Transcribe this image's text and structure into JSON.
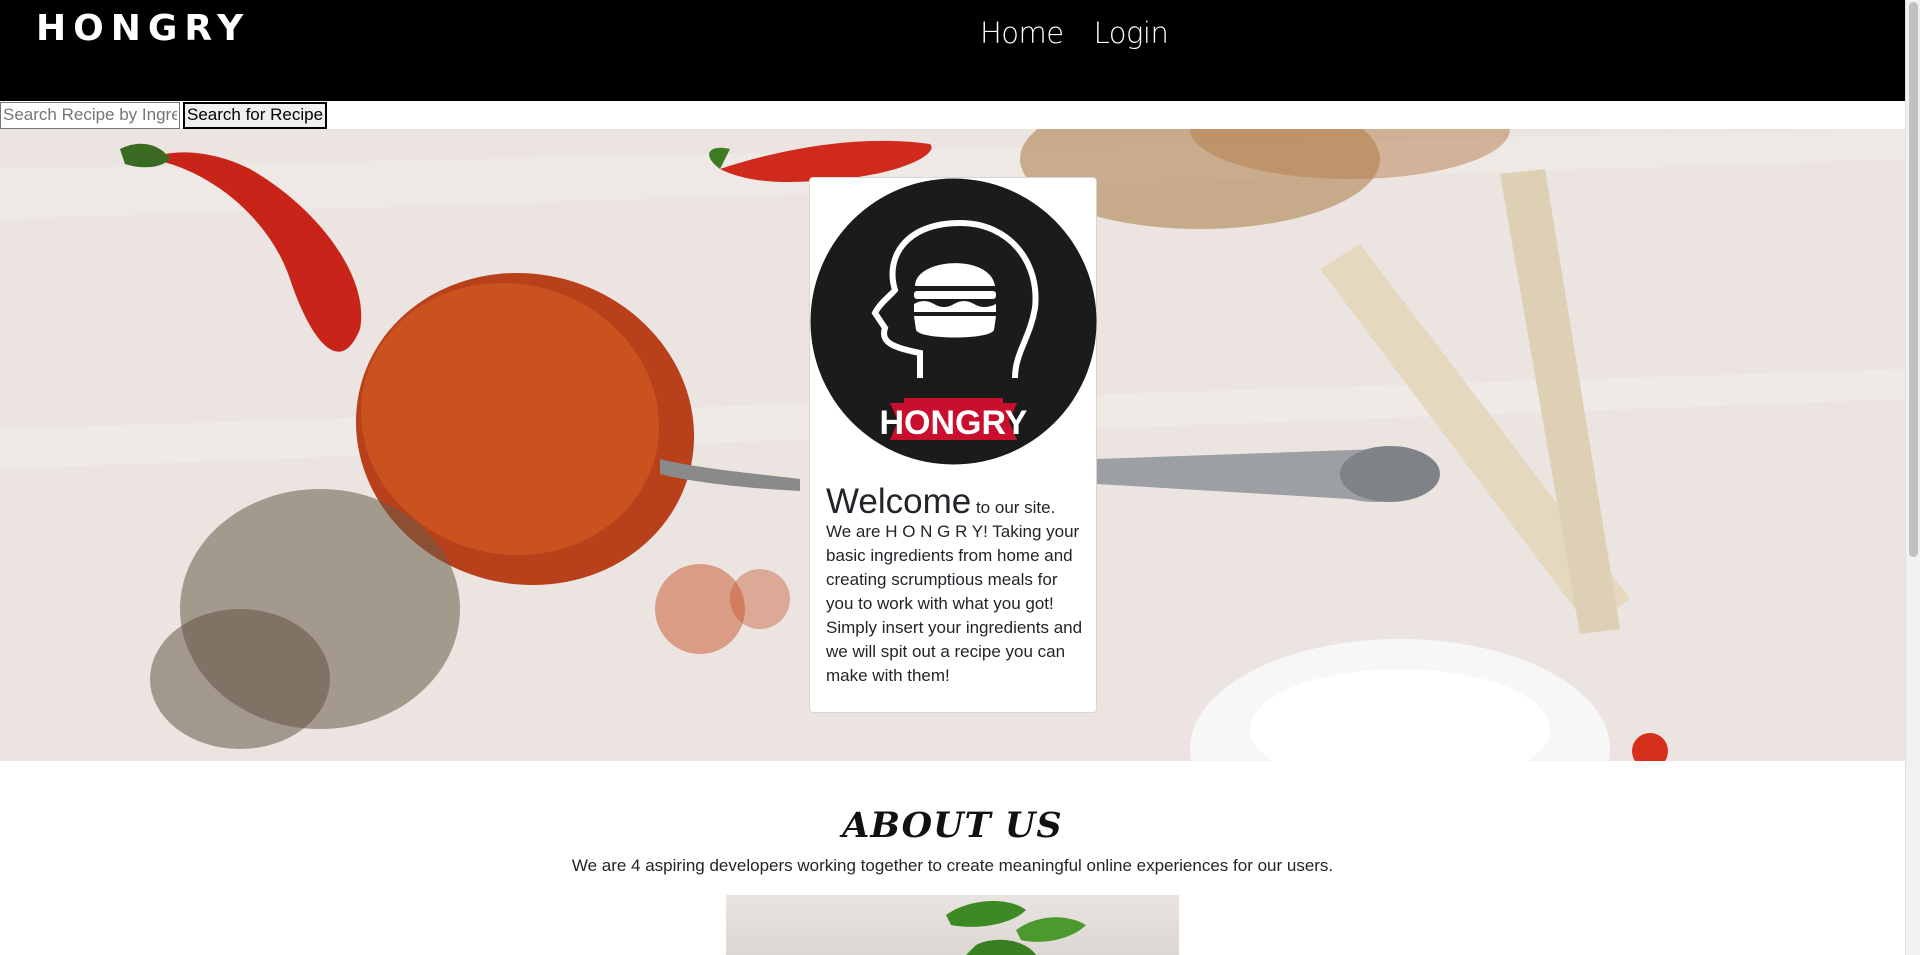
{
  "header": {
    "brand": "HONGRY",
    "nav": [
      {
        "label": "Home"
      },
      {
        "label": "Login"
      }
    ]
  },
  "search": {
    "placeholder": "Search Recipe by Ingredients",
    "button_label": "Search for Recipe"
  },
  "welcome": {
    "logo_text": "HONGRY",
    "heading": "Welcome",
    "text": " to our site. We are H O N G R Y! Taking your basic ingredients from home and creating scrumptious meals for you to work with what you got! Simply insert your ingredients and we will spit out a recipe you can make with them!"
  },
  "about": {
    "title": "ABOUT US",
    "text": "We are 4 aspiring developers working together to create meaningful online experiences for our users."
  },
  "colors": {
    "header_bg": "#000000",
    "logo_red": "#c8102e",
    "logo_dark": "#1b1b1b"
  }
}
